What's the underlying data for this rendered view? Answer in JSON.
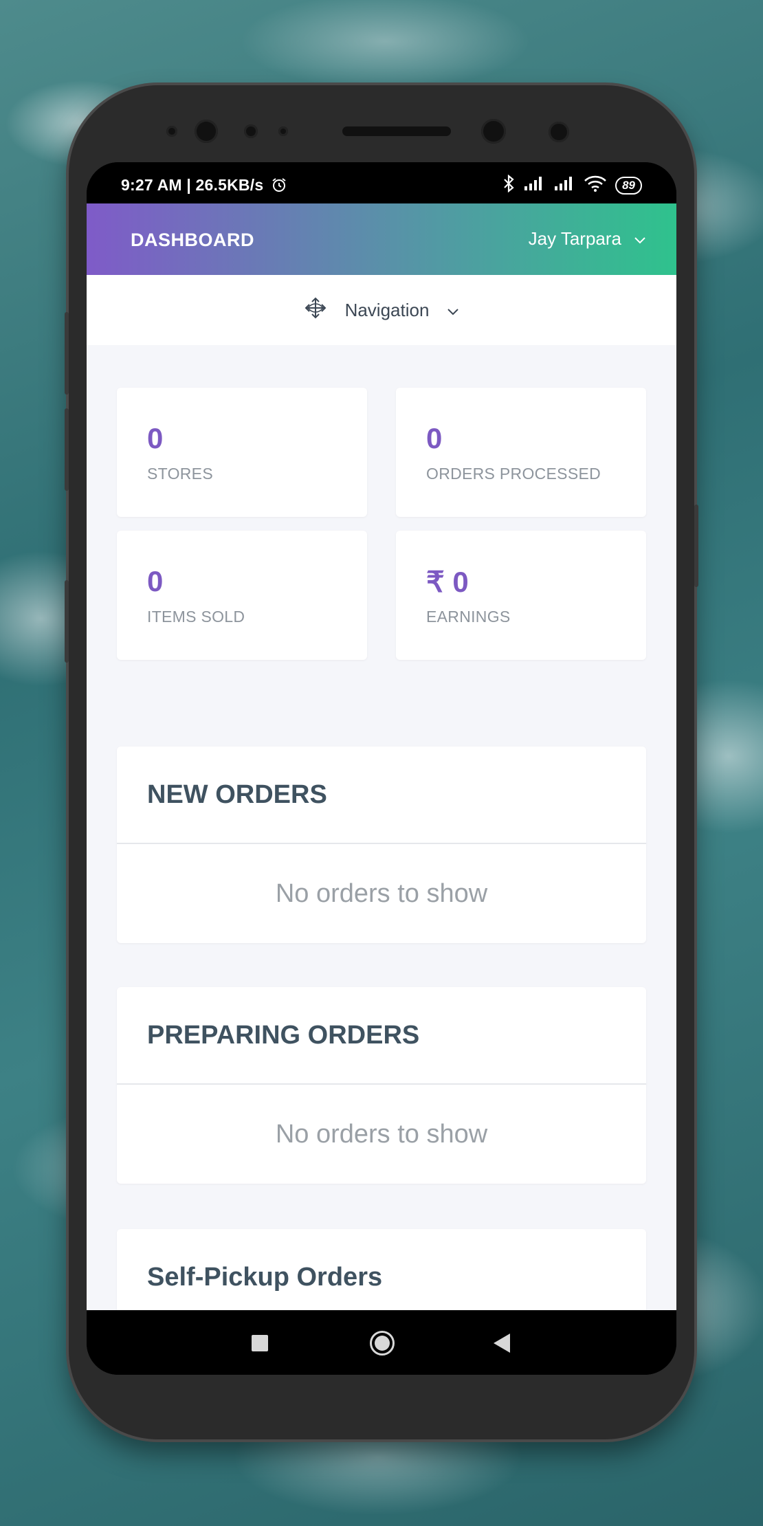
{
  "status_bar": {
    "time_speed": "9:27 AM | 26.5KB/s",
    "battery": "89",
    "icons": [
      "alarm-icon",
      "bluetooth-icon",
      "signal-icon",
      "signal-icon",
      "wifi-icon",
      "battery-icon"
    ]
  },
  "header": {
    "title": "DASHBOARD",
    "user_name": "Jay Tarpara",
    "gradient_start": "#7f5bc8",
    "gradient_end": "#2fc28d"
  },
  "navigation": {
    "label": "Navigation",
    "icon": "move-arrows-icon"
  },
  "stats": [
    {
      "value": "0",
      "label": "STORES"
    },
    {
      "value": "0",
      "label": "ORDERS PROCESSED"
    },
    {
      "value": "0",
      "label": "ITEMS SOLD"
    },
    {
      "value": "₹ 0",
      "label": "EARNINGS"
    }
  ],
  "sections": [
    {
      "title": "NEW ORDERS",
      "empty_text": "No orders to show"
    },
    {
      "title": "PREPARING ORDERS",
      "empty_text": "No orders to show"
    },
    {
      "title": "Self-Pickup Orders"
    }
  ],
  "colors": {
    "accent": "#7c59c2",
    "background": "#f5f6fa",
    "section_title": "#3f5260"
  }
}
